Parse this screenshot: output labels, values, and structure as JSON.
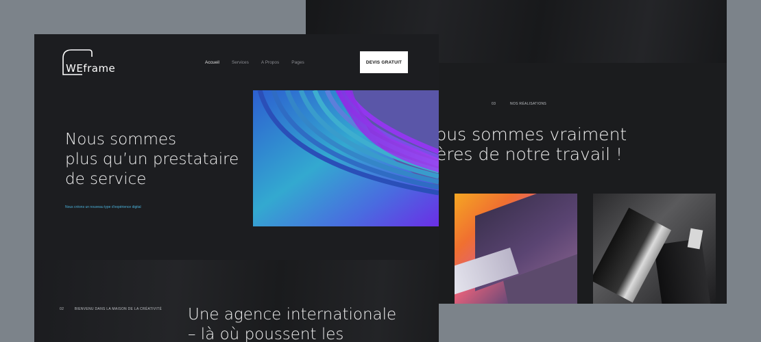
{
  "back_panel": {
    "section_number": "03",
    "section_label": "NOS RÉALISATIONS",
    "heading_line1": "ous sommes vraiment",
    "heading_line2": "ères de notre travail !"
  },
  "header": {
    "logo_text": "WEframe",
    "nav": [
      {
        "label": "Accueil",
        "active": true
      },
      {
        "label": "Services",
        "active": false
      },
      {
        "label": "A Propos",
        "active": false
      },
      {
        "label": "Pages",
        "active": false
      }
    ],
    "cta_label": "DEVIS GRATUIT"
  },
  "hero": {
    "title_line1": "Nous sommes",
    "title_line2": "plus qu’un prestataire",
    "title_line3": "de service",
    "subtitle": "Nous créons un nouveau type d’expérience digital"
  },
  "bottom": {
    "section_number": "02",
    "section_label": "BIENVENU DANS LA MAISON DE LA CRÉATIVITÉ",
    "title_line1": "Une agence internationale",
    "title_line2": "– là où poussent les"
  },
  "colors": {
    "accent": "#4ab0d9",
    "panel_bg": "#1c1d20",
    "page_bg": "#7c838a"
  }
}
